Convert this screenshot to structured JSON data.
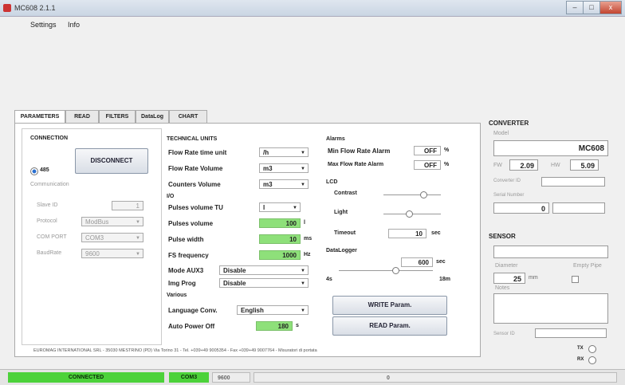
{
  "window": {
    "title": "MC608 2.1.1",
    "controls": [
      "–",
      "□",
      "x"
    ]
  },
  "menu": [
    "Settings",
    "Info"
  ],
  "tabs": [
    "PARAMETERS",
    "READ",
    "FILTERS",
    "DataLog",
    "CHART"
  ],
  "connection": {
    "title": "CONNECTION",
    "disconnect": "DISCONNECT",
    "radio_label": "485",
    "communication": "Communication",
    "slave_id_label": "Slave ID",
    "slave_id": "1",
    "protocol_label": "Protocol",
    "protocol": "ModBus",
    "com_port_label": "COM PORT",
    "com_port": "COM3",
    "baudrate_label": "BaudRate",
    "baudrate": "9600"
  },
  "tech_units": {
    "title": "TECHNICAL UNITS",
    "flow_rate_unit_label": "Flow Rate time unit",
    "flow_rate_unit": "/h",
    "flow_rate_volume_label": "Flow Rate Volume",
    "flow_rate_volume": "m3",
    "counters_volume_label": "Counters Volume",
    "counters_volume": "m3"
  },
  "io": {
    "title": "I/O",
    "pulses_volume_tu_label": "Pulses volume TU",
    "pulses_volume_tu": "l",
    "pulses_volume_label": "Pulses volume",
    "pulses_volume": "100",
    "pulses_volume_unit": "l",
    "pulse_width_label": "Pulse width",
    "pulse_width": "10",
    "pulse_width_unit": "ms",
    "fs_frequency_label": "FS frequency",
    "fs_frequency": "1000",
    "fs_frequency_unit": "Hz",
    "mode_aux_label": "Mode AUX3",
    "mode_aux": "Disable",
    "img_prog_label": "Img Prog",
    "img_prog": "Disable"
  },
  "various": {
    "title": "Various",
    "language_label": "Language Conv.",
    "language": "English",
    "auto_power_off_label": "Auto Power Off",
    "auto_power_off": "180",
    "auto_power_off_unit": "s"
  },
  "alarms": {
    "title": "Alarms",
    "min_label": "Min Flow Rate Alarm",
    "min_value": "OFF",
    "min_unit": "%",
    "max_label": "Max Flow Rate Alarm",
    "max_value": "OFF",
    "max_unit": "%"
  },
  "lcd": {
    "title": "LCD",
    "contrast_label": "Contrast",
    "contrast_level": 0.7,
    "light_label": "Light",
    "light_level": 0.45,
    "timeout_label": "Timeout",
    "timeout": "10",
    "timeout_unit": "sec"
  },
  "datalogger": {
    "title": "DataLogger",
    "interval": "600",
    "interval_unit": "sec",
    "min_label": "4s",
    "max_label": "18m",
    "level": 0.6
  },
  "actions": {
    "write": "WRITE Param.",
    "read": "READ Param."
  },
  "converter": {
    "title": "CONVERTER",
    "model_label": "Model",
    "model": "MC608",
    "fw_label": "FW",
    "fw": "2.09",
    "hw_label": "HW",
    "hw": "5.09",
    "converter_id_label": "Converter ID",
    "serial_label": "Serial Number",
    "serial": "0"
  },
  "sensor": {
    "title": "SENSOR",
    "diameter_label": "Diameter",
    "diameter": "25",
    "diameter_unit": "mm",
    "empty_pipe_label": "Empty Pipe",
    "notes_label": "Notes",
    "sensor_id_label": "Sensor ID"
  },
  "indicators": {
    "tx": "TX",
    "rx": "RX"
  },
  "footer": "EUROMAG INTERNATIONAL SRL - 35030 MESTRINO (PD) Via Torino 31 - Tel. +039+49 9005354 - Fax +039+49 9007764 - Misuratori di portata",
  "status": {
    "connected": "CONNECTED",
    "port": "COM3",
    "baud": "9600",
    "counter": "0"
  },
  "colors": {
    "accent_green": "#4cd23a",
    "field_green": "#8ee07a"
  }
}
